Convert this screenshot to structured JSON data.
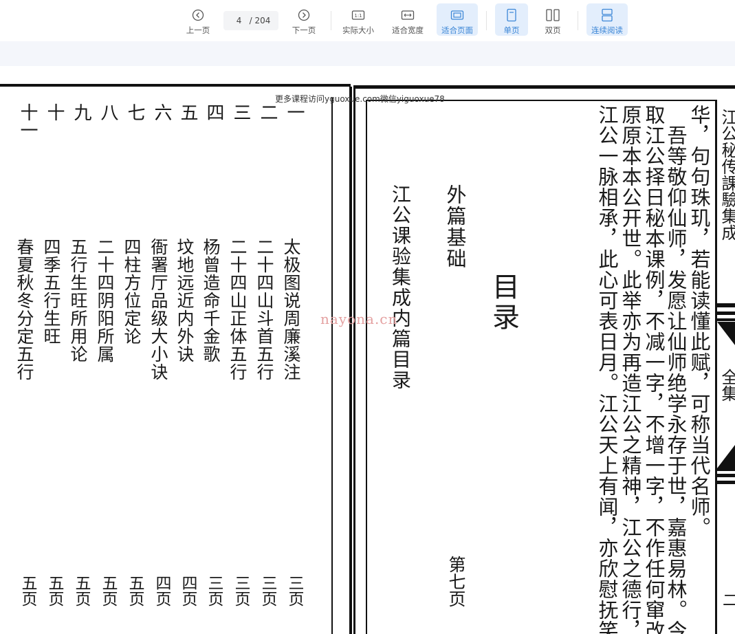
{
  "toolbar": {
    "prev_label": "上一页",
    "current_page": "4",
    "total_pages": "/ 204",
    "next_label": "下一页",
    "actual_size_label": "实际大小",
    "fit_width_label": "适合宽度",
    "fit_page_label": "适合页面",
    "single_page_label": "单页",
    "double_page_label": "双页",
    "continuous_label": "连续阅读",
    "accent_color": "#3b86d6",
    "active_bg_color": "#e3eefc"
  },
  "watermarks": {
    "top": "更多课程访问yguoxue.com微信yiguoxue78",
    "middle": "nayona.cn"
  },
  "left_page": {
    "numbers": [
      "十一",
      "十",
      "九",
      "八",
      "七",
      "六",
      "五",
      "四",
      "三",
      "二",
      "一"
    ],
    "entries": [
      "春夏秋冬分定五行",
      "四季五行生旺",
      "五行生旺所用论",
      "二十四阴阳所属",
      "四柱方位定论",
      "衙署厅品级大小诀",
      "坟地远近内外诀",
      "杨曾造命千金歌",
      "二十四山正体五行",
      "二十四山斗首五行",
      "太极图说周廉溪注"
    ],
    "pages": [
      "五页",
      "五页",
      "五页",
      "五页",
      "五页",
      "四页",
      "四页",
      "三页",
      "三页",
      "三页",
      "三页"
    ]
  },
  "right_page": {
    "book_title": "江公课验集成内篇目录",
    "section": "外篇基础",
    "heading": "目录",
    "page_ref": "第七页",
    "text_lines": [
      "江公一脉相承，此心可表日月。江公天上有闻，亦欣慰抚笑矣",
      "原原本本公开世。此举亦为再造江公之精神，江公之德行，",
      "取江公择日秘本课例，不减一字，不增一字，不作任何窜改",
      "吾等敬仰仙师，发愿让仙师绝学永存于世，嘉惠易林。今",
      "华，句句珠玑，若能读懂此赋，可称当代名师。"
    ]
  },
  "next_page_edge": {
    "title_fragment": "江公秘传課驗集成",
    "fragment": "全集",
    "page_num": "二"
  }
}
